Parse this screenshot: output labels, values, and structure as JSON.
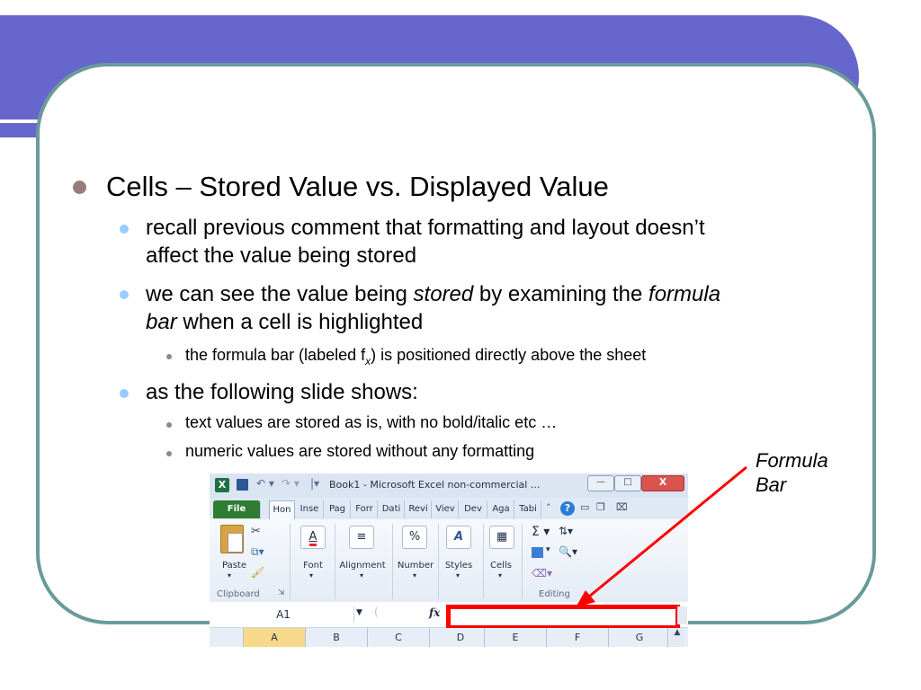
{
  "slide": {
    "bullet1": "Cells – Stored Value vs. Displayed Value",
    "b2a_line1": "recall previous comment that formatting and layout doesn’t",
    "b2a_line2": "affect the value being stored",
    "b2b_p1": "we can see the value being ",
    "b2b_em1": "stored",
    "b2b_p2": " by examining the ",
    "b2b_em2": "formula",
    "b2b_em3": "bar",
    "b2b_p3": " when a cell is highlighted",
    "b3a_p1": "the formula bar (labeled f",
    "b3a_sub": "x",
    "b3a_p2": ") is positioned directly above the sheet",
    "b2c": "as the following slide shows:",
    "b3b": "text values are stored as is, with no bold/italic etc …",
    "b3c": "numeric values are stored without any formatting",
    "callout_line1": "Formula",
    "callout_line2": "Bar"
  },
  "excel": {
    "title": "Book1 - Microsoft Excel non-commercial ...",
    "tabs": [
      "File",
      "Hon",
      "Inse",
      "Pag",
      "Forr",
      "Dati",
      "Revi",
      "Viev",
      "Dev",
      "Aga",
      "Tabi"
    ],
    "groups": {
      "paste": "Paste",
      "font": "Font",
      "alignment": "Alignment",
      "number": "Number",
      "styles": "Styles",
      "cells": "Cells",
      "clipboard": "Clipboard",
      "editing": "Editing"
    },
    "name_box": "A1",
    "fx": "fx",
    "columns": [
      "A",
      "B",
      "C",
      "D",
      "E",
      "F",
      "G"
    ]
  },
  "colors": {
    "banner": "#6666cc",
    "frame": "#6b9a9a",
    "bullet_l1": "#9a7b7b",
    "bullet_l2": "#99ccff",
    "highlight": "#ff0000"
  }
}
